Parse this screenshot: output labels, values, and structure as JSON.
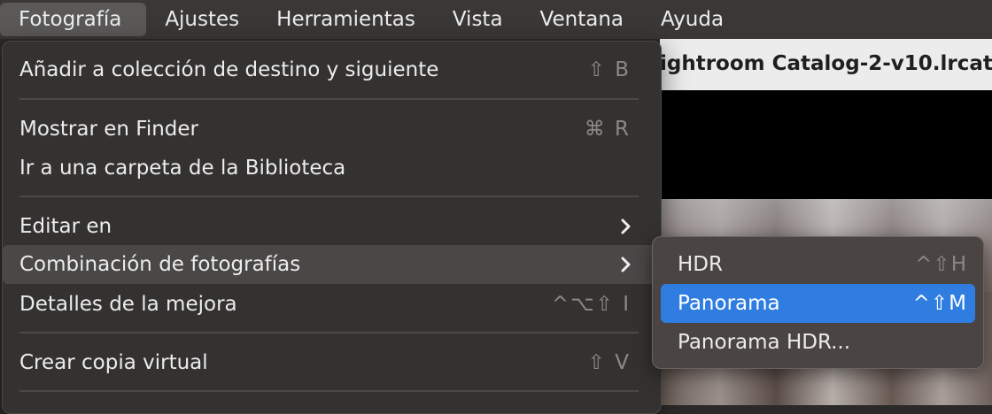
{
  "menubar": {
    "items": [
      "Fotografía",
      "Ajustes",
      "Herramientas",
      "Vista",
      "Ventana",
      "Ayuda"
    ]
  },
  "window": {
    "title": "ightroom Catalog-2-v10.lrcat"
  },
  "menu": {
    "items": [
      {
        "label": "Añadir a colección de destino y siguiente",
        "shortcut": "⇧ B"
      },
      {
        "label": "Mostrar en Finder",
        "shortcut": "⌘ R"
      },
      {
        "label": "Ir a una carpeta de la Biblioteca",
        "shortcut": ""
      },
      {
        "label": "Editar en",
        "shortcut": ""
      },
      {
        "label": "Combinación de fotografías",
        "shortcut": ""
      },
      {
        "label": "Detalles de la mejora",
        "shortcut": "^⌥⇧ I"
      },
      {
        "label": "Crear copia virtual",
        "shortcut": "⇧ V"
      }
    ]
  },
  "submenu": {
    "items": [
      {
        "label": "HDR",
        "shortcut": "^⇧H"
      },
      {
        "label": "Panorama",
        "shortcut": "^⇧M"
      },
      {
        "label": "Panorama HDR...",
        "shortcut": ""
      }
    ]
  },
  "icons": {
    "chevron_right": "chevron-right-icon"
  },
  "colors": {
    "selection": "#2f7de1",
    "menu_bg": "#343231"
  }
}
